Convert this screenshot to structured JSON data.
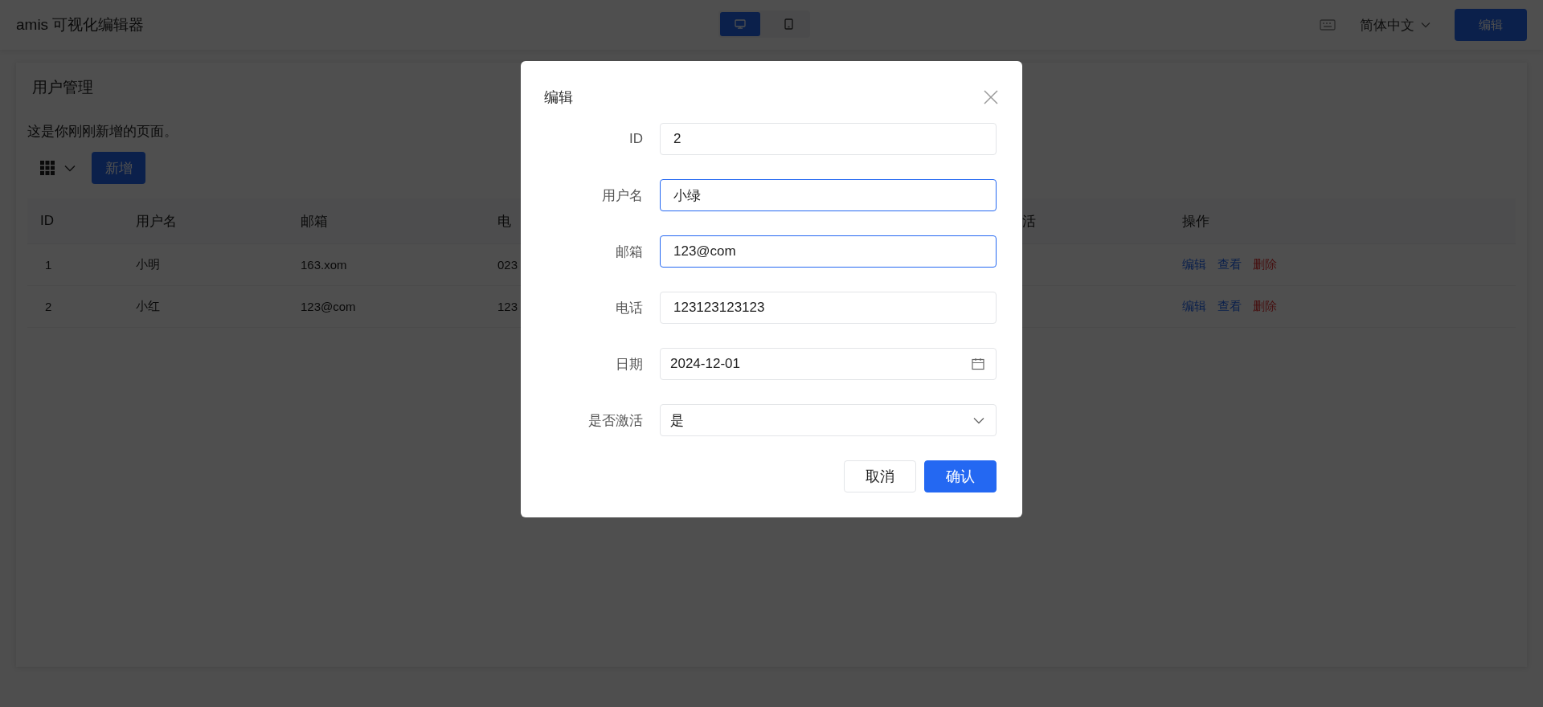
{
  "header": {
    "title": "amis 可视化编辑器",
    "devices": [
      {
        "kind": "desktop",
        "selected": true
      },
      {
        "kind": "tablet",
        "selected": false
      }
    ],
    "language": "简体中文",
    "edit_button": "编辑"
  },
  "page": {
    "title": "用户管理",
    "description": "这是你刚刚新增的页面。",
    "add_button": "新增",
    "table": {
      "columns": [
        "ID",
        "用户名",
        "邮箱",
        "电",
        "活",
        "操作"
      ],
      "rows": [
        {
          "cells": [
            "1",
            "小明",
            "163.xom",
            "023"
          ],
          "actions": [
            {
              "label": "编辑",
              "kind": "link"
            },
            {
              "label": "查看",
              "kind": "link"
            },
            {
              "label": "删除",
              "kind": "danger"
            }
          ]
        },
        {
          "cells": [
            "2",
            "小红",
            "123@com",
            "123"
          ],
          "actions": [
            {
              "label": "编辑",
              "kind": "link"
            },
            {
              "label": "查看",
              "kind": "link"
            },
            {
              "label": "删除",
              "kind": "danger"
            }
          ]
        }
      ]
    }
  },
  "dialog": {
    "title": "编辑",
    "fields": [
      {
        "label": "ID",
        "kind": "text",
        "value": "2",
        "active": false
      },
      {
        "label": "用户名",
        "kind": "text",
        "value": "小绿",
        "active": true
      },
      {
        "label": "邮箱",
        "kind": "text",
        "value": "123@com",
        "active": true
      },
      {
        "label": "电话",
        "kind": "text",
        "value": "123123123123",
        "active": false
      },
      {
        "label": "日期",
        "kind": "date",
        "value": "2024-12-01",
        "active": false
      },
      {
        "label": "是否激活",
        "kind": "select",
        "value": "是",
        "active": false
      }
    ],
    "buttons": [
      {
        "label": "取消",
        "kind": "default"
      },
      {
        "label": "确认",
        "kind": "primary"
      }
    ]
  }
}
